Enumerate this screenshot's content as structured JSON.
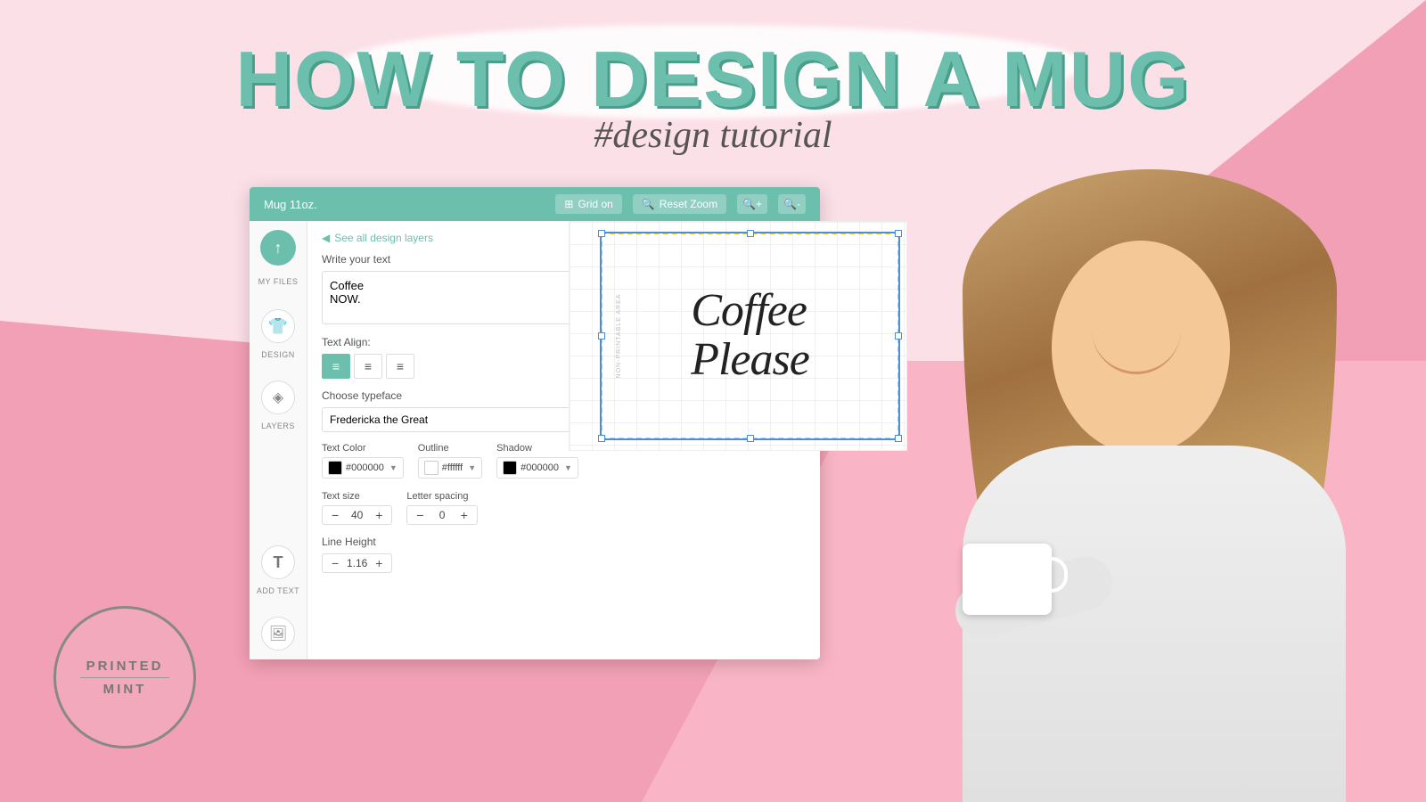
{
  "background": {
    "color_main": "#f2a0b5",
    "color_light": "#fce0e8"
  },
  "header": {
    "main_title": "HOW TO DESIGN A MUG",
    "subtitle": "#design tutorial"
  },
  "logo": {
    "line1": "PRINTED",
    "line2": "MINT"
  },
  "editor": {
    "product_name": "Mug 11oz.",
    "grid_btn": "Grid on",
    "reset_zoom_btn": "Reset Zoom",
    "back_link": "See all design layers",
    "write_text_label": "Write your text",
    "text_content": "Coffee\nNOW.",
    "align_label": "Text Align:",
    "align_options": [
      "left",
      "center",
      "right"
    ],
    "typeface_label": "Choose typeface",
    "typeface_value": "Fredericka the Great",
    "text_color_label": "Text Color",
    "text_color_value": "#000000",
    "outline_label": "Outline",
    "outline_color_value": "#ffffff",
    "shadow_label": "Shadow",
    "shadow_color_value": "#000000",
    "text_size_label": "Text size",
    "text_size_value": "40",
    "letter_spacing_label": "Letter spacing",
    "letter_spacing_value": "0",
    "line_height_label": "Line Height",
    "line_height_value": "1.16",
    "sidebar": {
      "my_files_label": "MY FILES",
      "design_label": "DESIGN",
      "layers_label": "LAYERS",
      "add_text_label": "ADD TEXT"
    }
  },
  "canvas": {
    "mug_text_line1": "Coffee",
    "mug_text_line2": "Please",
    "printable_area_label": "NON-PRINTABLE AREA"
  }
}
